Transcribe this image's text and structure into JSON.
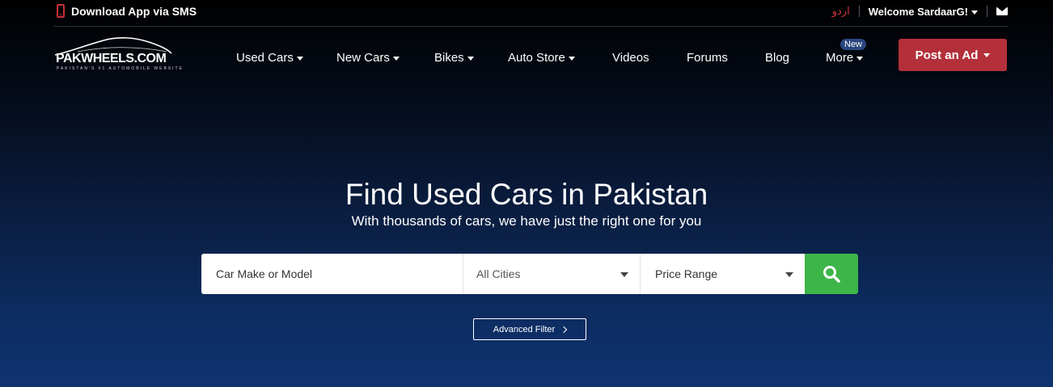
{
  "topbar": {
    "sms_label": "Download App via SMS",
    "urdu_label": "اردو",
    "welcome_label": "Welcome SardaarG!"
  },
  "logo": {
    "text": "PAKWHEELS.COM",
    "tagline": "PAKISTAN'S #1 AUTOMOBILE WEBSITE"
  },
  "nav": {
    "items": [
      {
        "label": "Used Cars",
        "dropdown": true
      },
      {
        "label": "New Cars",
        "dropdown": true
      },
      {
        "label": "Bikes",
        "dropdown": true
      },
      {
        "label": "Auto Store",
        "dropdown": true
      },
      {
        "label": "Videos",
        "dropdown": false
      },
      {
        "label": "Forums",
        "dropdown": false
      },
      {
        "label": "Blog",
        "dropdown": false
      },
      {
        "label": "More",
        "dropdown": true
      }
    ],
    "new_badge": "New",
    "post_ad_label": "Post an Ad"
  },
  "hero": {
    "title": "Find Used Cars in Pakistan",
    "subtitle": "With thousands of cars, we have just the right one for you"
  },
  "search": {
    "model_placeholder": "Car Make or Model",
    "city_value": "All Cities",
    "price_value": "Price Range",
    "advanced_label": "Advanced Filter"
  },
  "colors": {
    "accent_red": "#b3303a",
    "search_green": "#3eb549",
    "badge_blue": "#29467f"
  }
}
